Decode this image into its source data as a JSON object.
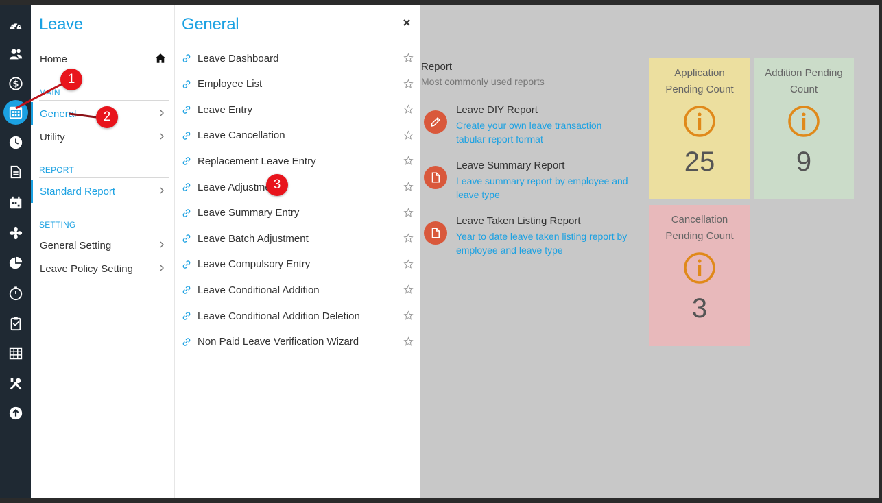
{
  "rail": {
    "icons": [
      "dashboard-icon",
      "users-icon",
      "dollar-icon",
      "calendar-grid-icon",
      "clock-icon",
      "document-icon",
      "calendar-icon",
      "flower-icon",
      "pie-chart-icon",
      "timer-icon",
      "clipboard-icon",
      "table-icon",
      "tools-icon",
      "upload-icon"
    ],
    "active": "calendar-grid-icon"
  },
  "leave_panel": {
    "title": "Leave",
    "home": "Home",
    "main_section": "MAIN",
    "main_items": [
      "General",
      "Utility"
    ],
    "report_section": "REPORT",
    "report_items": [
      "Standard Report"
    ],
    "setting_section": "SETTING",
    "setting_items": [
      "General Setting",
      "Leave Policy Setting"
    ]
  },
  "general_panel": {
    "title": "General",
    "items": [
      "Leave Dashboard",
      "Employee List",
      "Leave Entry",
      "Leave Cancellation",
      "Replacement Leave Entry",
      "Leave Adjustment",
      "Leave Summary Entry",
      "Leave Batch Adjustment",
      "Leave Compulsory Entry",
      "Leave Conditional Addition",
      "Leave Conditional Addition Deletion",
      "Non Paid Leave Verification Wizard"
    ]
  },
  "report": {
    "title": "Report",
    "subtitle": "Most commonly used reports",
    "items": [
      {
        "name": "Leave DIY Report",
        "desc": "Create your own leave transaction tabular report format",
        "icon": "pencil-icon"
      },
      {
        "name": "Leave Summary Report",
        "desc": "Leave summary report by employee and leave type",
        "icon": "document-icon"
      },
      {
        "name": "Leave Taken Listing Report",
        "desc": "Year to date leave taken listing report by employee and leave type",
        "icon": "document-icon"
      }
    ]
  },
  "cards": [
    {
      "label": "Application Pending Count",
      "count": "25",
      "color": "#ecdf9f"
    },
    {
      "label": "Addition Pending Count",
      "count": "9",
      "color": "#cbdcc9"
    },
    {
      "label": "Cancellation Pending Count",
      "count": "3",
      "color": "#e8b9bb"
    }
  ],
  "markers": [
    "1",
    "2",
    "3"
  ],
  "colors": {
    "accent": "#1ba1e2",
    "report_icon": "#d9583b",
    "info_icon": "#e0891a",
    "marker": "#e8141c"
  }
}
